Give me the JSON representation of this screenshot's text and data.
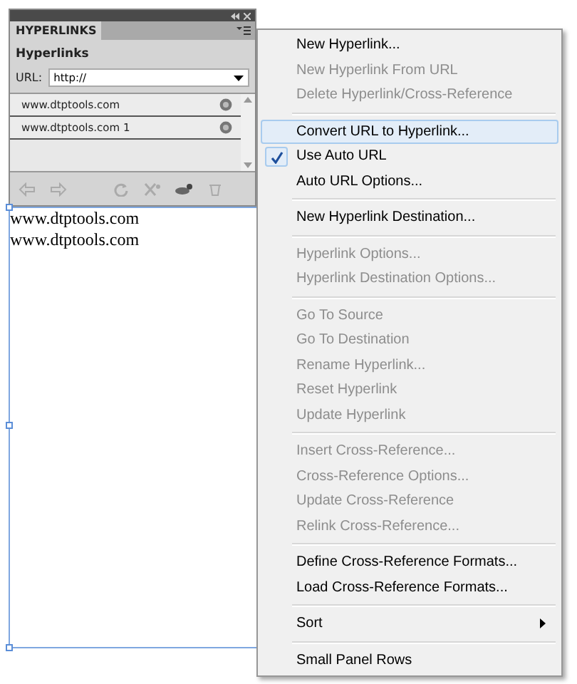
{
  "panel": {
    "tab": "HYPERLINKS",
    "heading": "Hyperlinks",
    "url_label": "URL:",
    "url_value": "http://",
    "links": [
      {
        "label": "www.dtptools.com",
        "selected": false
      },
      {
        "label": "www.dtptools.com 1",
        "selected": false
      }
    ]
  },
  "document": {
    "lines": [
      "www.dtptools.com",
      "www.dtptools.com"
    ]
  },
  "menu": {
    "groups": [
      [
        {
          "label": "New Hyperlink...",
          "kind": "command",
          "disabled": false,
          "checked": false,
          "selected": false
        },
        {
          "label": "New Hyperlink From URL",
          "kind": "command",
          "disabled": true,
          "checked": false,
          "selected": false
        },
        {
          "label": "Delete Hyperlink/Cross-Reference",
          "kind": "command",
          "disabled": true,
          "checked": false,
          "selected": false
        }
      ],
      [
        {
          "label": "Convert URL to Hyperlink...",
          "kind": "command",
          "disabled": false,
          "checked": false,
          "selected": true
        },
        {
          "label": "Use Auto URL",
          "kind": "command",
          "disabled": false,
          "checked": true,
          "selected": false
        },
        {
          "label": "Auto URL Options...",
          "kind": "command",
          "disabled": false,
          "checked": false,
          "selected": false
        }
      ],
      [
        {
          "label": "New Hyperlink Destination...",
          "kind": "command",
          "disabled": false,
          "checked": false,
          "selected": false
        }
      ],
      [
        {
          "label": "Hyperlink Options...",
          "kind": "command",
          "disabled": true,
          "checked": false,
          "selected": false
        },
        {
          "label": "Hyperlink Destination Options...",
          "kind": "command",
          "disabled": true,
          "checked": false,
          "selected": false
        }
      ],
      [
        {
          "label": "Go To Source",
          "kind": "command",
          "disabled": true,
          "checked": false,
          "selected": false
        },
        {
          "label": "Go To Destination",
          "kind": "command",
          "disabled": true,
          "checked": false,
          "selected": false
        },
        {
          "label": "Rename Hyperlink...",
          "kind": "command",
          "disabled": true,
          "checked": false,
          "selected": false
        },
        {
          "label": "Reset Hyperlink",
          "kind": "command",
          "disabled": true,
          "checked": false,
          "selected": false
        },
        {
          "label": "Update Hyperlink",
          "kind": "command",
          "disabled": true,
          "checked": false,
          "selected": false
        }
      ],
      [
        {
          "label": "Insert Cross-Reference...",
          "kind": "command",
          "disabled": true,
          "checked": false,
          "selected": false
        },
        {
          "label": "Cross-Reference Options...",
          "kind": "command",
          "disabled": true,
          "checked": false,
          "selected": false
        },
        {
          "label": "Update Cross-Reference",
          "kind": "command",
          "disabled": true,
          "checked": false,
          "selected": false
        },
        {
          "label": "Relink Cross-Reference...",
          "kind": "command",
          "disabled": true,
          "checked": false,
          "selected": false
        }
      ],
      [
        {
          "label": "Define Cross-Reference Formats...",
          "kind": "command",
          "disabled": false,
          "checked": false,
          "selected": false
        },
        {
          "label": "Load Cross-Reference Formats...",
          "kind": "command",
          "disabled": false,
          "checked": false,
          "selected": false
        }
      ],
      [
        {
          "label": "Sort",
          "kind": "submenu",
          "disabled": false,
          "checked": false,
          "selected": false
        }
      ],
      [
        {
          "label": "Small Panel Rows",
          "kind": "command",
          "disabled": false,
          "checked": false,
          "selected": false
        }
      ]
    ]
  }
}
